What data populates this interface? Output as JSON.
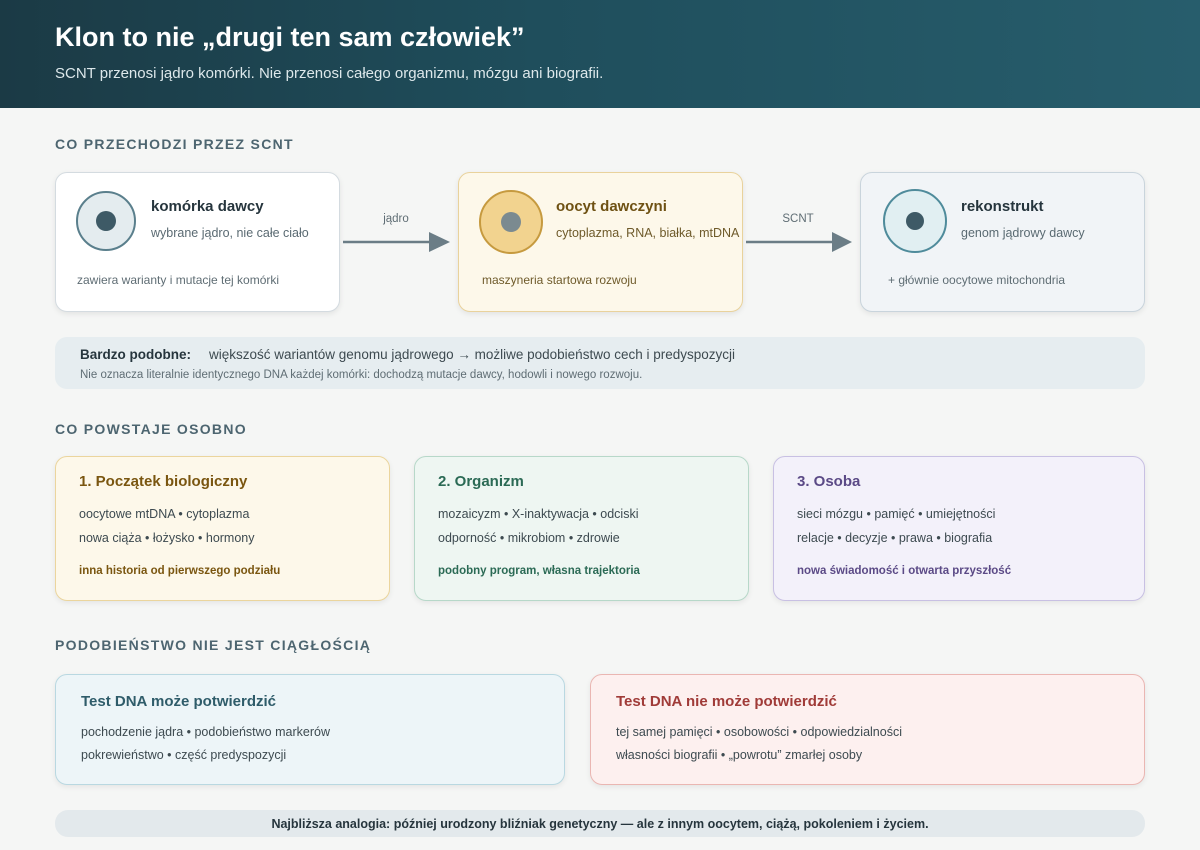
{
  "header": {
    "title": "Klon to nie „drugi ten sam człowiek”",
    "subtitle": "SCNT przenosi jądro komórki. Nie przenosi całego organizmu, mózgu ani biografii."
  },
  "section1": {
    "title": "CO PRZECHODZI PRZEZ SCNT",
    "steps": [
      {
        "title": "komórka dawcy",
        "sub": "wybrane jądro, nie całe ciało",
        "note": "zawiera warianty i mutacje tej komórki"
      },
      {
        "title": "oocyt dawczyni",
        "sub": "cytoplazma, RNA, białka, mtDNA",
        "note": "maszyneria startowa rozwoju"
      },
      {
        "title": "rekonstrukt",
        "sub": "genom jądrowy dawcy",
        "note": "+ głównie oocytowe mitochondria"
      }
    ],
    "arrows": [
      "jądro",
      "SCNT"
    ],
    "similar": {
      "label": "Bardzo podobne:",
      "value": "większość wariantów genomu jądrowego → możliwe podobieństwo cech i predyspozycji",
      "note": "Nie oznacza literalnie identycznego DNA każdej komórki: dochodzą mutacje dawcy, hodowli i nowego rozwoju."
    }
  },
  "section2": {
    "title": "CO POWSTAJE OSOBNO",
    "cards": [
      {
        "title": "1. Początek biologiczny",
        "lines": [
          "oocytowe mtDNA • cytoplazma",
          "nowa ciąża • łożysko • hormony"
        ],
        "footer": "inna historia od pierwszego podziału"
      },
      {
        "title": "2. Organizm",
        "lines": [
          "mozaicyzm • X-inaktywacja • odciski",
          "odporność • mikrobiom • zdrowie"
        ],
        "footer": "podobny program, własna trajektoria"
      },
      {
        "title": "3. Osoba",
        "lines": [
          "sieci mózgu • pamięć • umiejętności",
          "relacje • decyzje • prawa • biografia"
        ],
        "footer": "nowa świadomość i otwarta przyszłość"
      }
    ]
  },
  "section3": {
    "title": "PODOBIEŃSTWO NIE JEST CIĄGŁOŚCIĄ",
    "can": {
      "title": "Test DNA może potwierdzić",
      "lines": [
        "pochodzenie jądra • podobieństwo markerów",
        "pokrewieństwo • część predyspozycji"
      ]
    },
    "cannot": {
      "title": "Test DNA nie może potwierdzić",
      "lines": [
        "tej samej pamięci • osobowości • odpowiedzialności",
        "własności biografii • „powrotu” zmarłej osoby"
      ]
    }
  },
  "analogy": "Najbliższa analogia: później urodzony bliźniak genetyczny — ale z innym oocytem, ciążą, pokoleniem i życiem.",
  "colors": {
    "header_start": "#1b3a45",
    "header_end": "#275d6c",
    "donor_bg": "#ffffff",
    "oocyte_bg": "#fdf8ea",
    "oocyte_text": "#6e5113",
    "recon_bg": "#f1f4f7",
    "teal_text": "#2b6a55",
    "purple_text": "#5b4a86",
    "can_text": "#2f5c6a",
    "cannot_text": "#a03b38"
  }
}
